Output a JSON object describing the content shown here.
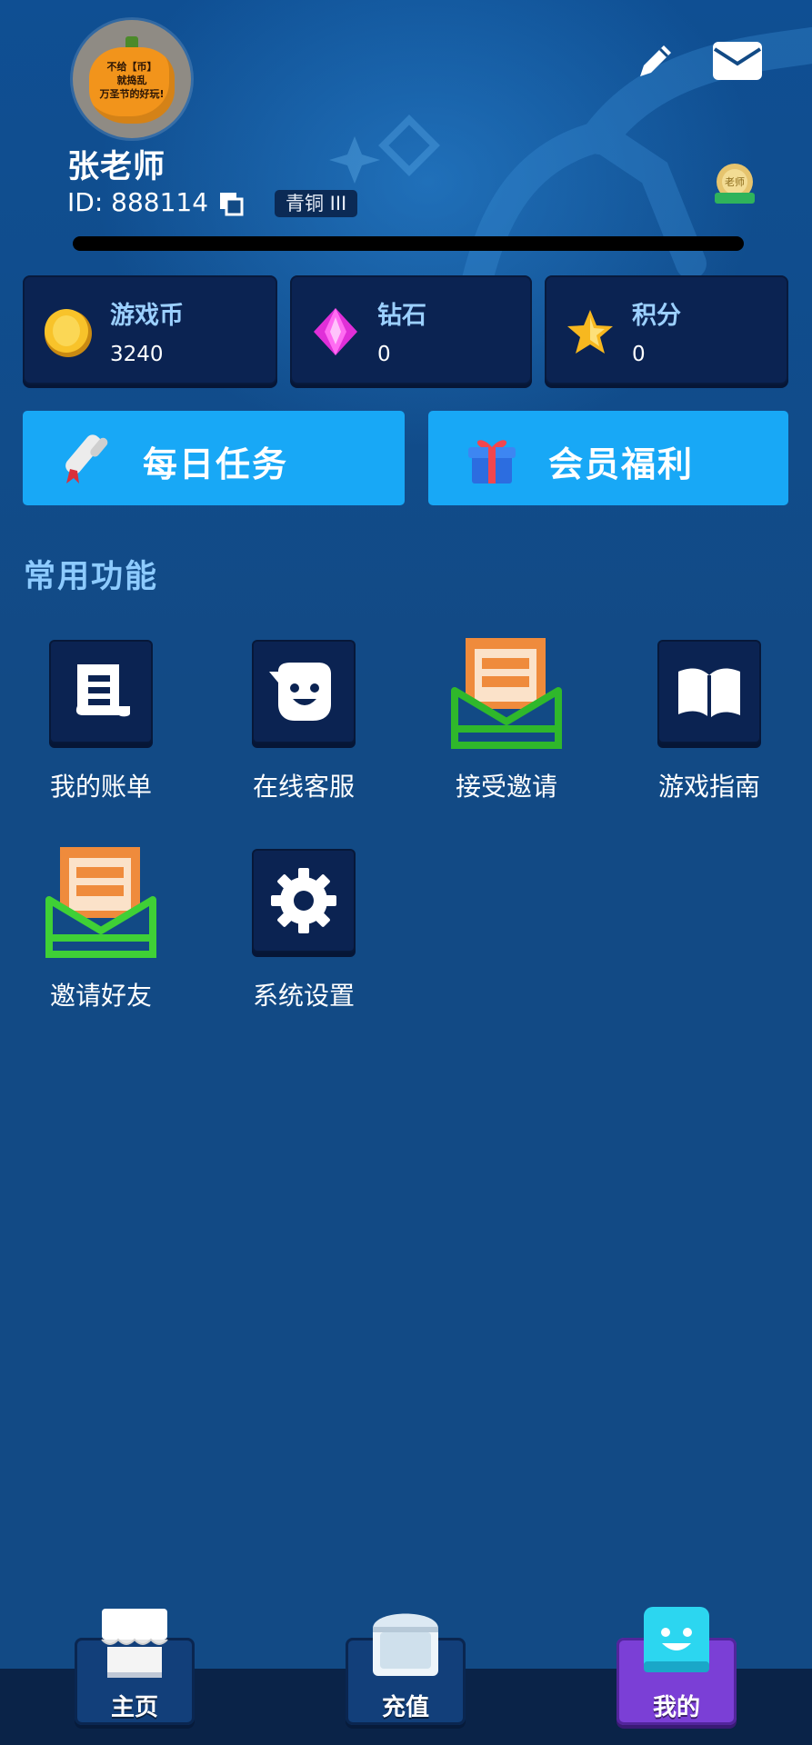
{
  "profile": {
    "avatar_text_line1": "不给【币】",
    "avatar_text_line2": "就捣乱",
    "avatar_text_line3": "万圣节的好玩!",
    "username": "张老师",
    "id_text": "ID: 888114",
    "rank": "青铜 III",
    "medal_text": "老师"
  },
  "currencies": [
    {
      "label": "游戏币",
      "value": "3240",
      "icon": "coin-icon"
    },
    {
      "label": "钻石",
      "value": "0",
      "icon": "diamond-icon"
    },
    {
      "label": "积分",
      "value": "0",
      "icon": "star-icon"
    }
  ],
  "buttons": {
    "daily_tasks": "每日任务",
    "member_benefits": "会员福利"
  },
  "section_title": "常用功能",
  "functions": [
    {
      "label": "我的账单",
      "icon": "bill-icon"
    },
    {
      "label": "在线客服",
      "icon": "support-chat-icon"
    },
    {
      "label": "接受邀请",
      "icon": "accept-invite-envelope-icon"
    },
    {
      "label": "游戏指南",
      "icon": "guide-book-icon"
    },
    {
      "label": "邀请好友",
      "icon": "invite-envelope-icon"
    },
    {
      "label": "系统设置",
      "icon": "gear-icon"
    }
  ],
  "nav": [
    {
      "label": "主页",
      "icon": "shop-home-icon"
    },
    {
      "label": "充值",
      "icon": "treasure-chest-icon"
    },
    {
      "label": "我的",
      "icon": "smiley-profile-icon"
    }
  ],
  "colors": {
    "background": "#124a85",
    "card": "#0b2352",
    "accent_button": "#18a8f6",
    "section_title": "#8dcbff",
    "active_tab": "#7b3fd6"
  }
}
